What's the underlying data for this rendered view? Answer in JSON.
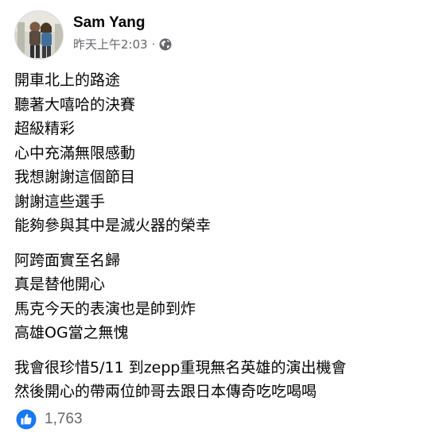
{
  "post": {
    "author": "Sam Yang",
    "timestamp": "昨天上午2:03",
    "separator": "·",
    "audience_icon": "globe-icon",
    "paragraphs": [
      [
        "開車北上的路途",
        "聽著大嘻哈的決賽",
        "超級精彩",
        "心中充滿無限感動",
        "我想謝謝這個節目",
        "謝謝這些選手",
        "能夠參與其中是滅火器的榮幸"
      ],
      [
        "阿跨面實至名歸",
        "真是替他開心",
        "馬克今天的表演也是帥到炸",
        "高雄OG當之無愧"
      ],
      [
        "我會很珍惜5/11 到zepp重現無名英雄的演出機會",
        "然後開心的帶兩位帥哥去跟日本傳奇吃吃喝喝"
      ]
    ]
  },
  "reactions": {
    "icon": "like-icon",
    "count": "1,763",
    "like_color": "#1877f2"
  }
}
